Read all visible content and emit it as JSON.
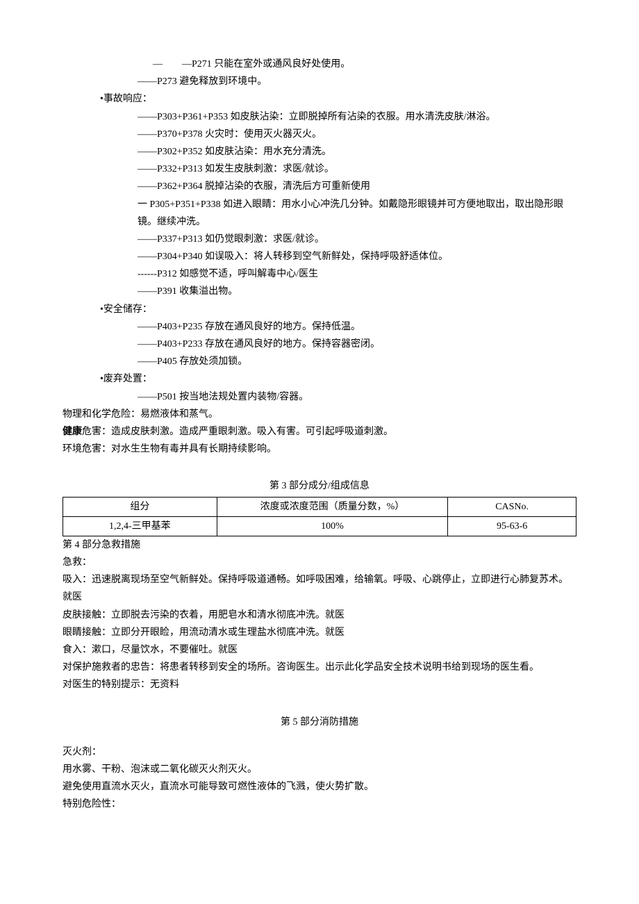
{
  "lines": {
    "l1": "—　　—P271 只能在室外或通风良好处使用。",
    "l2": "——P273 避免释放到环境中。",
    "l3": "•事故响应：",
    "l4": "——P303+P361+P353 如皮肤沾染：立即脱掉所有沾染的衣服。用水清洗皮肤/淋浴。",
    "l5": "——P370+P378 火灾时：使用灭火器灭火。",
    "l6": "——P302+P352 如皮肤沾染：用水充分清洗。",
    "l7": "——P332+P313 如发生皮肤刺激：求医/就诊。",
    "l8": "——P362+P364 脱掉沾染的衣服，清洗后方可重新使用",
    "l9": "一 P305+P351+P338 如进入眼睛：用水小心冲洗几分钟。如戴隐形眼镜并可方便地取出，取出隐形眼镜。继续冲洗。",
    "l10": "——P337+P313 如仍觉眼刺激：求医/就诊。",
    "l11": "——P304+P340 如误吸入：将人转移到空气新鲜处，保持呼吸舒适体位。",
    "l12": "------P312 如感觉不适，呼叫解毒中心/医生",
    "l13": "——P391 收集溢出物。",
    "l14": "•安全储存：",
    "l15": "——P403+P235 存放在通风良好的地方。保持低温。",
    "l16": "——P403+P233 存放在通风良好的地方。保持容器密闭。",
    "l17": "——P405 存放处须加锁。",
    "l18": "•废弃处置：",
    "l19": "——P501 按当地法规处置内装物/容器。",
    "l20": "物理和化学危险：易燃液体和蒸气。",
    "l21a": "健康",
    "l21b": "危害：造成皮肤刺激。造成严重眼刺激。吸入有害。可引起呼吸道刺激。",
    "l22": "环境危害：对水生生物有毒并具有长期持续影响。"
  },
  "section3": {
    "title": "第 3 部分成分/组成信息",
    "headers": [
      "组分",
      "浓度或浓度范围（质量分数，%）",
      "CASNo."
    ],
    "row": [
      "1,2,4-三甲基苯",
      "100%",
      "95-63-6"
    ]
  },
  "section4": {
    "title": "第 4 部分急救措施",
    "p1": "急救：",
    "p2": "吸入：迅速脱离现场至空气新鲜处。保持呼吸道通畅。如呼吸困难，给输氧。呼吸、心跳停止，立即进行心肺复苏术。就医",
    "p3": "皮肤接触：立即脱去污染的衣着，用肥皂水和清水彻底冲洗。就医",
    "p4": "眼睛接触：立即分开眼睑，用流动清水或生理盐水彻底冲洗。就医",
    "p5": "食入：漱口，尽量饮水，不要催吐。就医",
    "p6": "对保护施救者的忠告：将患者转移到安全的场所。咨询医生。出示此化学品安全技术说明书给到现场的医生看。",
    "p7": "对医生的特别提示：无资料"
  },
  "section5": {
    "title": "第 5 部分消防措施",
    "p1": "灭火剂：",
    "p2": "用水雾、干粉、泡沫或二氧化碳灭火剂灭火。",
    "p3": "避免使用直流水灭火，直流水可能导致可燃性液体的飞溅，使火势扩散。",
    "p4": "特别危险性："
  }
}
